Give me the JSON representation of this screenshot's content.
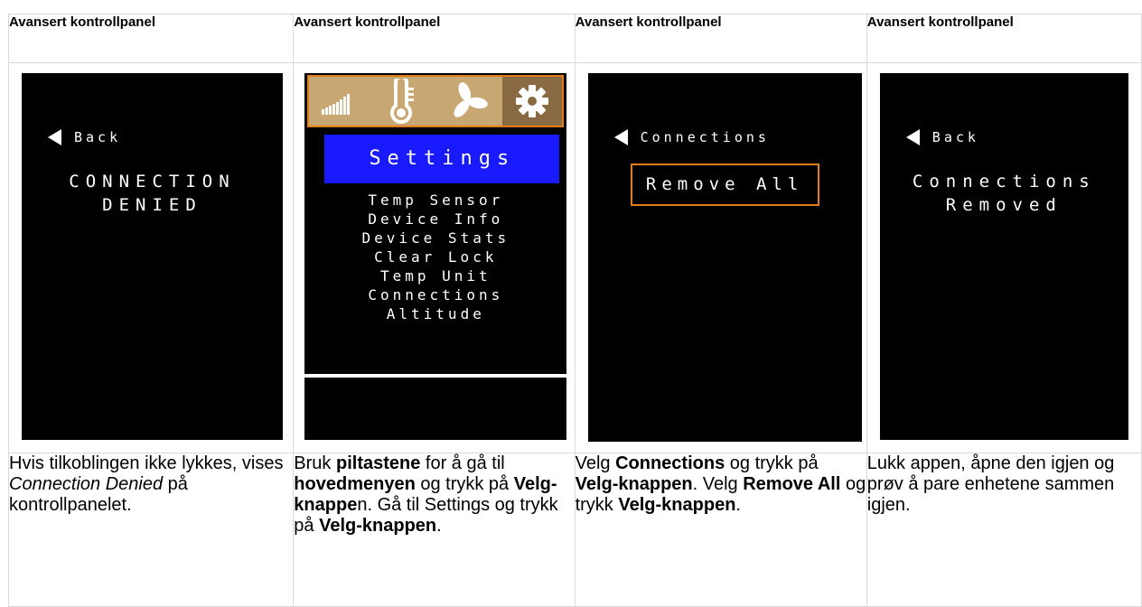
{
  "headers": [
    "Avansert kontrollpanel",
    "Avansert kontrollpanel",
    "Avansert kontrollpanel",
    "Avansert kontrollpanel"
  ],
  "screens": {
    "denied": {
      "back": "Back",
      "line1": "CONNECTION",
      "line2": "DENIED"
    },
    "settings": {
      "title": "Settings",
      "menu": [
        "Temp Sensor",
        "Device Info",
        "Device Stats",
        "Clear Lock",
        "Temp Unit",
        "Connections",
        "Altitude"
      ],
      "icons": [
        "signal-icon",
        "thermometer-icon",
        "fan-icon",
        "gear-icon"
      ]
    },
    "connections": {
      "back": "Connections",
      "button": "Remove All"
    },
    "removed": {
      "back": "Back",
      "line1": "Connections",
      "line2": "Removed"
    }
  },
  "descriptions": {
    "d1": {
      "a": "Hvis tilkoblingen ikke lykkes, vises ",
      "em": "Connection Denied",
      "b": " på kontrollpanelet."
    },
    "d2": {
      "a": "Bruk ",
      "b1": "piltastene",
      "c": " for å gå til ",
      "b2": "hovedmenyen",
      "d": " og trykk på ",
      "b3": "Velg-knappe",
      "e": "n. Gå til Settings og trykk på ",
      "b4": "Velg-knappen",
      "f": "."
    },
    "d3": {
      "a": "Velg ",
      "b1": "Connections",
      "c": " og trykk på ",
      "b2": "Velg-knappen",
      "d": ". Velg ",
      "b3": "Remove All",
      "e": " og trykk ",
      "b4": "Velg-knappen",
      "f": "."
    },
    "d4": {
      "text": "Lukk appen, åpne den igjen og prøv å pare enhetene sammen igjen."
    }
  },
  "colors": {
    "accent_orange": "#e07f19",
    "settings_blue": "#1a1aff",
    "iconbar_tan": "#c8a772"
  }
}
